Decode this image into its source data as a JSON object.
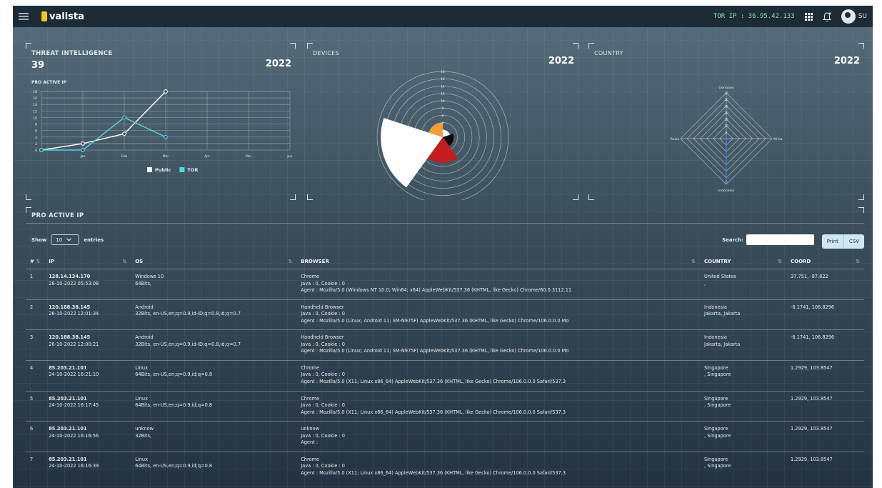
{
  "header": {
    "logo": "valista",
    "tor_ip": "TOR IP : 36.95.42.133",
    "user": "SU"
  },
  "threat": {
    "title": "THREAT INTELLIGENCE",
    "count": "39",
    "year": "2022",
    "subtitle": "PRO ACTIVE IP"
  },
  "devices": {
    "title": "DEVICES",
    "year": "2022"
  },
  "country": {
    "title": "COUNTRY",
    "year": "2022"
  },
  "chart_data": [
    {
      "type": "line",
      "x": [
        "",
        "Jan",
        "Feb",
        "Mar",
        "Apr",
        "Mei",
        "Jun"
      ],
      "yticks": [
        0,
        2,
        4,
        6,
        8,
        10,
        12,
        14,
        16,
        18
      ],
      "ylim": [
        0,
        18
      ],
      "legend_position": "bottom",
      "series": [
        {
          "name": "Public",
          "color": "#ffffff",
          "values": [
            0,
            2,
            5,
            18,
            null,
            null,
            null
          ]
        },
        {
          "name": "TOR",
          "color": "#4fd8e0",
          "values": [
            0,
            0,
            10,
            4,
            null,
            null,
            null
          ]
        }
      ]
    },
    {
      "type": "polar-area",
      "rticks": [
        0,
        2,
        4,
        6,
        8,
        10,
        12,
        14,
        16,
        18
      ],
      "rlim": [
        0,
        18
      ],
      "slices": [
        {
          "color": "#ffffff",
          "value": 2
        },
        {
          "color": "#0a0a0a",
          "value": 3
        },
        {
          "color": "#c31f1f",
          "value": 7
        },
        {
          "color": "#ffffff",
          "value": 17
        },
        {
          "color": "#f29c38",
          "value": 4
        }
      ]
    },
    {
      "type": "radar",
      "axes": [
        "Germany",
        "Africa",
        "Indonesia",
        "Rusia"
      ],
      "rticks": [
        0,
        5,
        10,
        15,
        20,
        25,
        30,
        35
      ],
      "rlim": [
        0,
        35
      ],
      "series": [
        {
          "color": "#4b7fd0",
          "values": [
            0,
            0,
            33,
            0
          ]
        }
      ]
    }
  ],
  "table": {
    "title": "PRO ACTIVE IP",
    "show_label": "Show",
    "entries_value": "10",
    "entries_label": "entries",
    "search_label": "Search:",
    "print_label": "Print",
    "csv_label": "CSV",
    "sort_icon": "⇅",
    "columns": [
      "#",
      "IP",
      "OS",
      "BROWSER",
      "COUNTRY",
      "COORD"
    ],
    "rows": [
      {
        "num": "1",
        "ip": "128.14.134.170",
        "time": "28-10-2022 05:53:08",
        "os": "Windows 10",
        "os_detail": "64Bits,",
        "browser": "Chrome",
        "java": "Java : 0, Cookie : 0",
        "agent": "Agent : Mozilla/5.0 (Windows NT 10.0; Win64; x64) AppleWebKit/537.36 (KHTML, like Gecko) Chrome/60.0.3112.11",
        "country": "United States",
        "city": ",",
        "coord": "37.751, -97.822"
      },
      {
        "num": "2",
        "ip": "120.188.38.145",
        "time": "26-10-2022 12:01:34",
        "os": "Android",
        "os_detail": "32Bits, en-US,en;q=0.9,id-ID;q=0.8,id;q=0.7",
        "browser": "Handheld Browser",
        "java": "Java : 0, Cookie : 0",
        "agent": "Agent : Mozilla/5.0 (Linux; Android 11; SM-N975F) AppleWebKit/537.36 (KHTML, like Gecko) Chrome/106.0.0.0 Mo",
        "country": "Indonesia",
        "city": "Jakarta, Jakarta",
        "coord": "-6.1741, 106.8296"
      },
      {
        "num": "3",
        "ip": "120.188.38.145",
        "time": "26-10-2022 12:00:21",
        "os": "Android",
        "os_detail": "32Bits, en-US,en;q=0.9,id-ID;q=0.8,id;q=0.7",
        "browser": "Handheld Browser",
        "java": "Java : 0, Cookie : 0",
        "agent": "Agent : Mozilla/5.0 (Linux; Android 11; SM-N975F) AppleWebKit/537.36 (KHTML, like Gecko) Chrome/106.0.0.0 Mo",
        "country": "Indonesia",
        "city": "Jakarta, Jakarta",
        "coord": "-6.1741, 106.8296"
      },
      {
        "num": "4",
        "ip": "85.203.21.101",
        "time": "24-10-2022 16:21:10",
        "os": "Linux",
        "os_detail": "64Bits, en-US,en;q=0.9,id;q=0.8",
        "browser": "Chrome",
        "java": "Java : 0, Cookie : 0",
        "agent": "Agent : Mozilla/5.0 (X11; Linux x86_64) AppleWebKit/537.36 (KHTML, like Gecko) Chrome/106.0.0.0 Safari/537.3",
        "country": "Singapore",
        "city": ", Singapore",
        "coord": "1.2929, 103.8547"
      },
      {
        "num": "5",
        "ip": "85.203.21.101",
        "time": "24-10-2022 16:17:45",
        "os": "Linux",
        "os_detail": "64Bits, en-US,en;q=0.9,id;q=0.8",
        "browser": "Chrome",
        "java": "Java : 0, Cookie : 0",
        "agent": "Agent : Mozilla/5.0 (X11; Linux x86_64) AppleWebKit/537.36 (KHTML, like Gecko) Chrome/106.0.0.0 Safari/537.3",
        "country": "Singapore",
        "city": ", Singapore",
        "coord": "1.2929, 103.8547"
      },
      {
        "num": "6",
        "ip": "85.203.21.101",
        "time": "24-10-2022 16:16:56",
        "os": "unknow",
        "os_detail": "32Bits,",
        "browser": "unknow",
        "java": "Java : 0, Cookie : 0",
        "agent": "Agent :",
        "country": "Singapore",
        "city": ", Singapore",
        "coord": "1.2929, 103.8547"
      },
      {
        "num": "7",
        "ip": "85.203.21.101",
        "time": "24-10-2022 16:16:39",
        "os": "Linux",
        "os_detail": "64Bits, en-US,en;q=0.9,id;q=0.8",
        "browser": "Chrome",
        "java": "Java : 0, Cookie : 0",
        "agent": "Agent : Mozilla/5.0 (X11; Linux x86_64) AppleWebKit/537.36 (KHTML, like Gecko) Chrome/106.0.0.0 Safari/537.3",
        "country": "Singapore",
        "city": ", Singapore",
        "coord": "1.2929, 103.8547"
      }
    ]
  }
}
